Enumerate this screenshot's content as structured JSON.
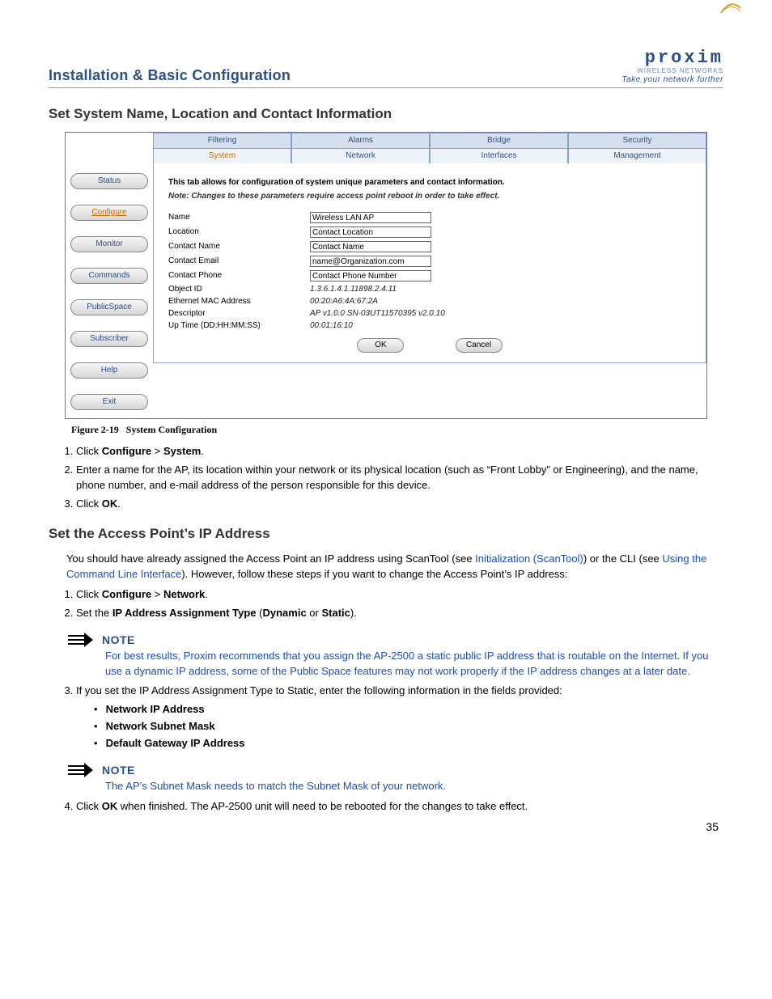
{
  "header": {
    "doc_title": "Installation & Basic Configuration",
    "logo_text": "proxim",
    "logo_sub": "WIRELESS NETWORKS",
    "logo_tagline": "Take your network further"
  },
  "section1": {
    "title": "Set System Name, Location and Contact Information"
  },
  "app": {
    "sidebar": [
      "Status",
      "Configure",
      "Monitor",
      "Commands",
      "PublicSpace",
      "Subscriber",
      "Help",
      "Exit"
    ],
    "tabs_top": [
      "Filtering",
      "Alarms",
      "Bridge",
      "Security"
    ],
    "tabs_bottom": [
      "System",
      "Network",
      "Interfaces",
      "Management"
    ],
    "desc": "This tab allows for configuration of system unique parameters and contact information.",
    "note": "Note: Changes to these parameters require access point reboot in order to take effect.",
    "fields": {
      "name_label": "Name",
      "name_value": "Wireless LAN AP",
      "location_label": "Location",
      "location_value": "Contact Location",
      "contact_name_label": "Contact Name",
      "contact_name_value": "Contact Name",
      "contact_email_label": "Contact Email",
      "contact_email_value": "name@Organization.com",
      "contact_phone_label": "Contact Phone",
      "contact_phone_value": "Contact Phone Number",
      "object_id_label": "Object ID",
      "object_id_value": "1.3.6.1.4.1.11898.2.4.11",
      "mac_label": "Ethernet MAC Address",
      "mac_value": "00:20:A6:4A:67:2A",
      "descriptor_label": "Descriptor",
      "descriptor_value": "AP v1.0.0 SN-03UT11570395 v2.0.10",
      "uptime_label": "Up Time (DD:HH:MM:SS)",
      "uptime_value": "00:01:16:10"
    },
    "ok": "OK",
    "cancel": "Cancel"
  },
  "figcaption": {
    "num": "Figure 2-19",
    "title": "System Configuration"
  },
  "steps1": {
    "s1a": "Click ",
    "s1b": "Configure",
    "s1c": " > ",
    "s1d": "System",
    "s1e": ".",
    "s2": "Enter a name for the AP, its location within your network or its physical location (such as “Front Lobby” or Engineering), and the name, phone number, and e-mail address of the person responsible for this device.",
    "s3a": "Click ",
    "s3b": "OK",
    "s3c": "."
  },
  "section2": {
    "title": "Set the Access Point’s IP Address",
    "intro_a": "You should have already assigned the Access Point an IP address using ScanTool (see ",
    "intro_link1": "Initialization (ScanTool)",
    "intro_b": ") or the CLI (see ",
    "intro_link2": "Using the Command Line Interface",
    "intro_c": "). However, follow these steps if you want to change the Access Point’s IP address:"
  },
  "steps2": {
    "s1a": "Click ",
    "s1b": "Configure",
    "s1c": " > ",
    "s1d": "Network",
    "s1e": ".",
    "s2a": "Set the ",
    "s2b": "IP Address Assignment Type",
    "s2c": " (",
    "s2d": "Dynamic",
    "s2e": " or ",
    "s2f": "Static",
    "s2g": ")."
  },
  "note1": {
    "label": "NOTE",
    "text": "For best results, Proxim recommends that you assign the AP-2500 a static public IP address that is routable on the Internet. If you use a dynamic IP address, some of the Public Space features may not work properly if the IP address changes at a later date."
  },
  "steps3": {
    "s3": "If you set the IP Address Assignment Type to Static, enter the following information in the fields provided:",
    "b1": "Network IP Address",
    "b2": "Network Subnet Mask",
    "b3": "Default Gateway IP Address"
  },
  "note2": {
    "label": "NOTE",
    "text": "The AP’s Subnet Mask needs to match the Subnet Mask of your network."
  },
  "steps4": {
    "s4a": "Click ",
    "s4b": "OK",
    "s4c": " when finished. The AP-2500 unit will need to be rebooted for the changes to take effect."
  },
  "page_number": "35"
}
